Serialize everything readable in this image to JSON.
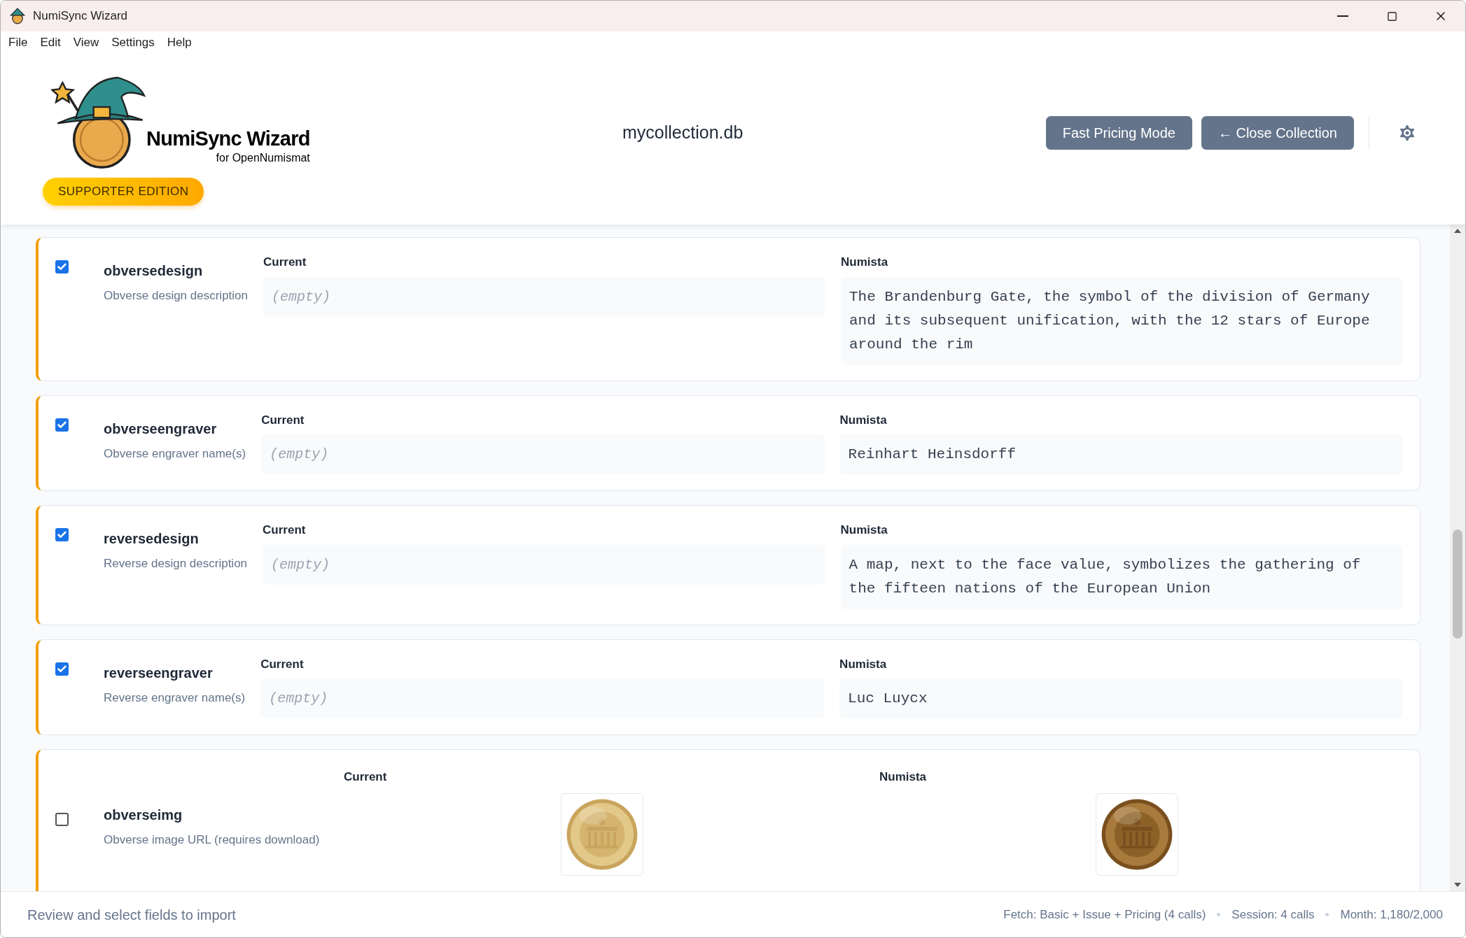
{
  "window": {
    "title": "NumiSync Wizard"
  },
  "menu": [
    "File",
    "Edit",
    "View",
    "Settings",
    "Help"
  ],
  "header": {
    "logo_title": "NumiSync Wizard",
    "logo_subtitle": "for OpenNumismat",
    "edition_badge": "SUPPORTER EDITION",
    "file_name": "mycollection.db",
    "buttons": [
      "Fast Pricing Mode",
      "← Close Collection"
    ]
  },
  "fields": [
    {
      "kind": "text",
      "checked": true,
      "name": "obversedesign",
      "description": "Obverse design description",
      "current_label": "Current",
      "current_value": "(empty)",
      "numista_label": "Numista",
      "numista_value": "The Brandenburg Gate, the symbol of the division of Germany and its subsequent unification, with the 12 stars of Europe around the rim"
    },
    {
      "kind": "text",
      "checked": true,
      "name": "obverseengraver",
      "description": "Obverse engraver name(s)",
      "current_label": "Current",
      "current_value": "(empty)",
      "numista_label": "Numista",
      "numista_value": "Reinhart Heinsdorff"
    },
    {
      "kind": "text",
      "checked": true,
      "name": "reversedesign",
      "description": "Reverse design description",
      "current_label": "Current",
      "current_value": "(empty)",
      "numista_label": "Numista",
      "numista_value": "A map, next to the face value, symbolizes the gathering of the fifteen nations of the European Union"
    },
    {
      "kind": "text",
      "checked": true,
      "name": "reverseengraver",
      "description": "Reverse engraver name(s)",
      "current_label": "Current",
      "current_value": "(empty)",
      "numista_label": "Numista",
      "numista_value": "Luc Luycx"
    },
    {
      "checked": false,
      "name": "obverseimg",
      "description": "Obverse image URL (requires download)",
      "current_label": "Current",
      "numista_label": "Numista"
    }
  ],
  "status_bar": {
    "message": "Review and select fields to import",
    "items": [
      "Fetch: Basic + Issue + Pricing (4 calls)",
      "Session: 4 calls",
      "Month: 1,180/2,000"
    ]
  }
}
